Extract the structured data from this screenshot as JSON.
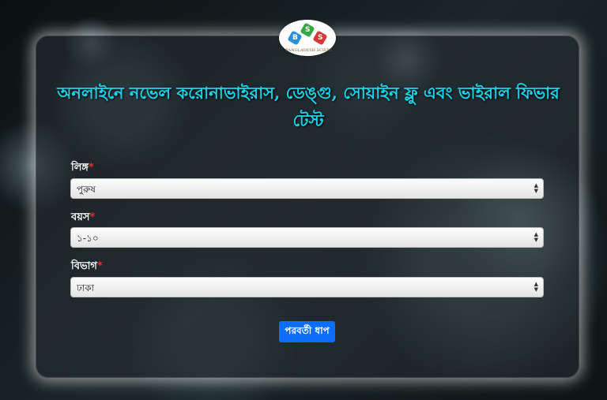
{
  "logo": {
    "letters": [
      "B",
      "S",
      "S"
    ],
    "text": "BANGLADESH SCIENCE SOCIETY"
  },
  "title": "অনলাইনে নভেল করোনাভাইরাস, ডেঙ্গু, সোয়াইন ফ্লু এবং ভাইরাল ফিভার টেস্ট",
  "form": {
    "gender": {
      "label": "লিঙ্গ",
      "required_mark": "*",
      "value": "পুরুষ"
    },
    "age": {
      "label": "বয়স",
      "required_mark": "*",
      "value": "১-১০"
    },
    "division": {
      "label": "বিভাগ",
      "required_mark": "*",
      "value": "ঢাকা"
    },
    "next_button": "পরবর্তী ধাপ"
  },
  "colors": {
    "title": "#19d3ea",
    "button": "#0d6efd",
    "required": "#e03030"
  }
}
